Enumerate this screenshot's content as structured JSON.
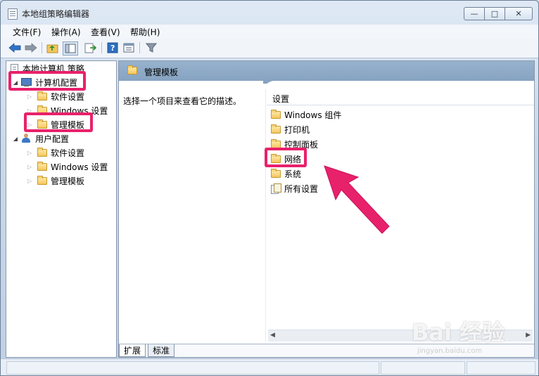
{
  "window": {
    "title": "本地组策略编辑器",
    "controls": {
      "minimize": "—",
      "maximize": "□",
      "close": "✕"
    }
  },
  "menu": [
    "文件(F)",
    "操作(A)",
    "查看(V)",
    "帮助(H)"
  ],
  "toolbar": [
    "back-icon",
    "forward-icon",
    "up-folder-icon",
    "show-hide-tree-icon",
    "export-list-icon",
    "help-icon",
    "properties-icon",
    "filter-icon"
  ],
  "tree": {
    "root": "本地计算机 策略",
    "computer_config": "计算机配置",
    "computer_children": [
      "软件设置",
      "Windows 设置",
      "管理模板"
    ],
    "user_config": "用户配置",
    "user_children": [
      "软件设置",
      "Windows 设置",
      "管理模板"
    ]
  },
  "right": {
    "header": "管理模板",
    "description": "选择一个项目来查看它的描述。",
    "list_header": "设置",
    "items": [
      "Windows 组件",
      "打印机",
      "控制面板",
      "网络",
      "系统",
      "所有设置"
    ]
  },
  "tabs": [
    "扩展",
    "标准"
  ],
  "highlight_color": "#e8216b",
  "watermark": {
    "brand": "Bai 经验",
    "site": "jingyan.baidu.com"
  }
}
